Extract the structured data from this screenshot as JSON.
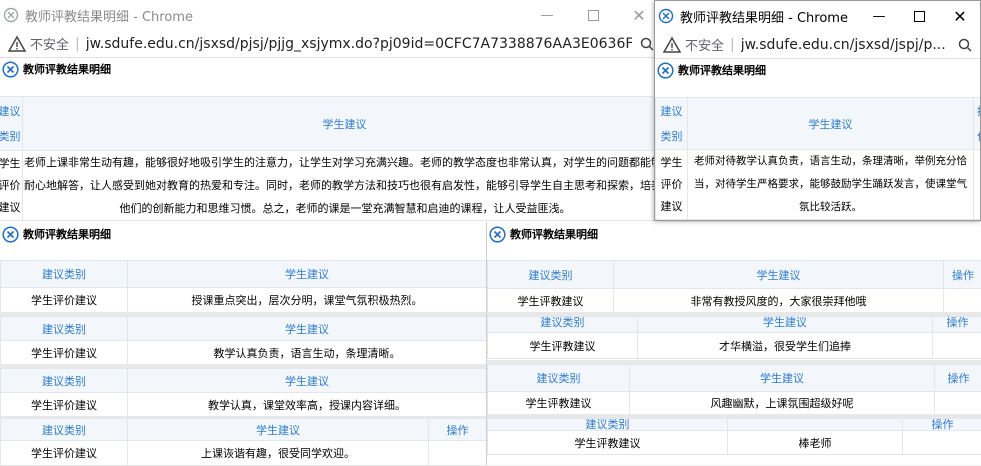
{
  "windows": {
    "back": {
      "title": "教师评教结果明细 - Chrome",
      "insecure": "不安全",
      "url": "jw.sdufe.edu.cn/jsxsd/pjsj/pjjg_xsjymx.do?pj09id=0CFC7A7338876AA3E0636F..."
    },
    "front": {
      "title": "教师评教结果明细 - Chrome",
      "insecure": "不安全",
      "url": "jw.sdufe.edu.cn/jsxsd/jspj/p..."
    }
  },
  "panel_title": "教师评教结果明细",
  "headers": {
    "type": "建议类别",
    "suggestion": "学生建议",
    "action": "操作"
  },
  "tall_panel": {
    "type_header_lines": [
      "建议",
      "类别"
    ],
    "type_cell_lines": [
      "学生",
      "评价",
      "建议"
    ],
    "suggestion_lines": [
      "老师上课非常生动有趣，能够很好地吸引学生的注意力，让学生对学习充满兴趣。老师的教学态度也非常认真，对学生的问题都能够",
      "耐心地解答，让人感受到她对教育的热爱和专注。同时，老师的教学方法和技巧也很有启发性，能够引导学生自主思考和探索，培养",
      "他们的创新能力和思维习惯。总之，老师的课是一堂充满智慧和启迪的课程，让人受益匪浅。"
    ]
  },
  "front_panel": {
    "type_header_lines": [
      "建议",
      "类别"
    ],
    "type_cell_lines": [
      "学生",
      "评价",
      "建议"
    ],
    "action_header_partial": [
      "操",
      "作"
    ],
    "suggestion_lines": [
      "老师对待教学认真负责，语言生动，条理清晰，举例充分恰",
      "当，对待学生严格要求，能够鼓励学生踊跃发言，使课堂气",
      "氛比较活跃。"
    ]
  },
  "left_rows": {
    "r1": {
      "type": "学生评价建议",
      "suggestion": "授课重点突出，层次分明，课堂气氛积极热烈。"
    },
    "r2": {
      "type": "学生评价建议",
      "suggestion": "教学认真负责，语言生动，条理清晰。"
    },
    "r3": {
      "type": "学生评价建议",
      "suggestion": "教学认真，课堂效率高，授课内容详细。"
    },
    "r4": {
      "type": "学生评价建议",
      "suggestion": "上课诙谐有趣，很受同学欢迎。"
    }
  },
  "right_rows": {
    "r1": {
      "type": "学生评教建议",
      "suggestion": "非常有教授风度的，大家很崇拜他哦"
    },
    "r2": {
      "type": "学生评教建议",
      "suggestion": "才华横溢，很受学生们追捧"
    },
    "r3": {
      "type": "学生评教建议",
      "suggestion": "风趣幽默，上课氛围超级好呢"
    },
    "r4": {
      "type": "学生评教建议",
      "suggestion": "棒老师"
    }
  },
  "colors": {
    "header_text": "#2b7bd3",
    "header_bg": "#f3f7fb",
    "close_icon": "#1d6ec9"
  }
}
